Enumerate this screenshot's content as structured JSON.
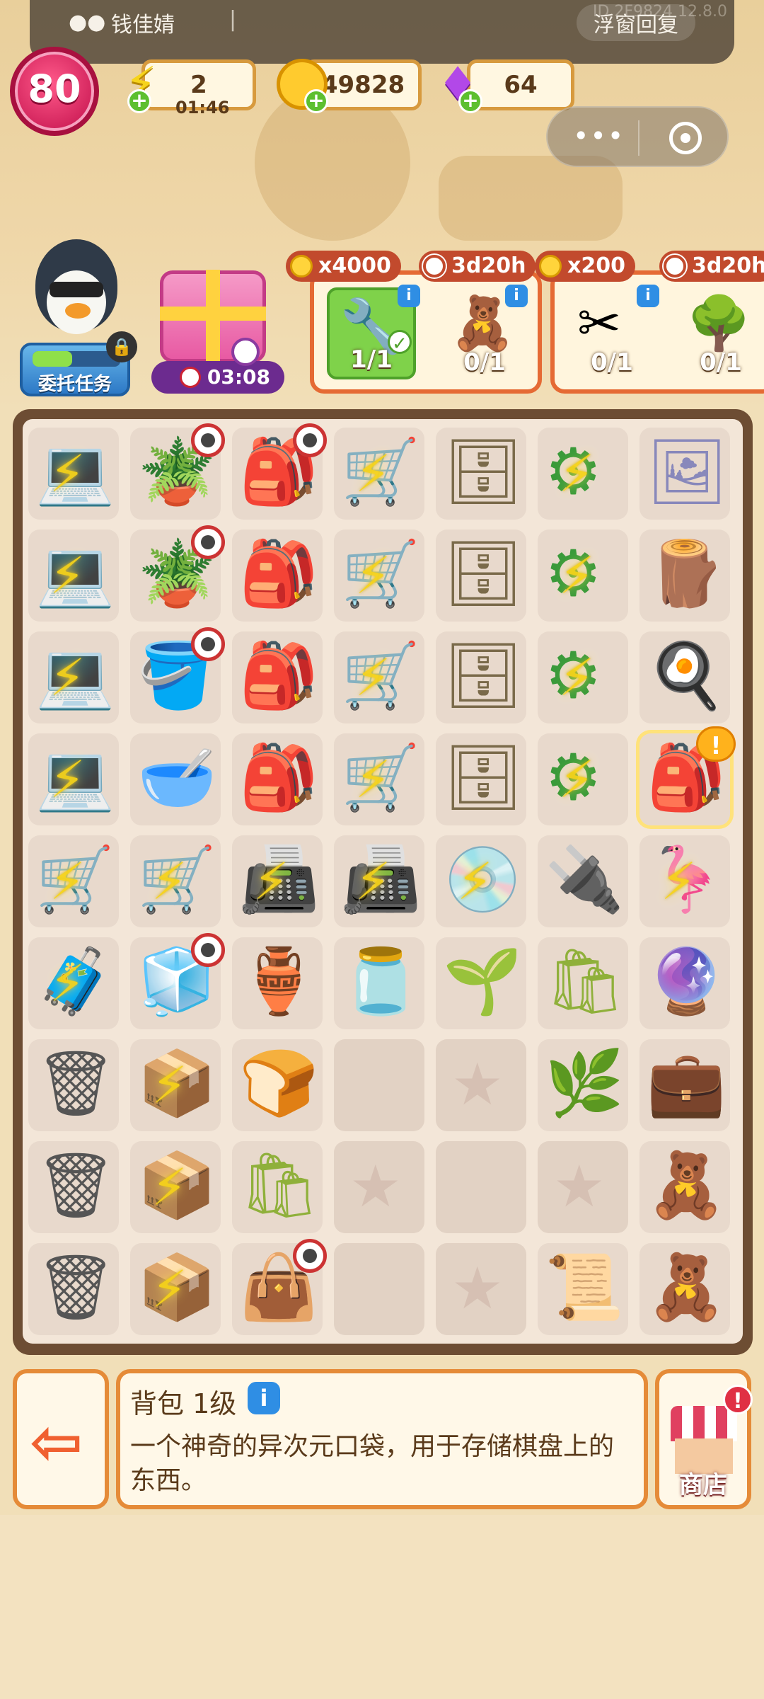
{
  "wechat_bar": {
    "name": "钱佳婧",
    "separator": "|",
    "right_label": "浮窗回复",
    "id_text": "ID 2F9824 12.8.0"
  },
  "level": {
    "value": "80"
  },
  "resources": {
    "energy": {
      "value": "2",
      "timer": "01:46",
      "icon": "energy-bolt-icon"
    },
    "coins": {
      "value": "49828",
      "icon": "coin-icon"
    },
    "gems": {
      "value": "64",
      "icon": "gem-icon"
    }
  },
  "capsule": {
    "more": "•••",
    "close": "close"
  },
  "mission": {
    "label": "委托任务",
    "progress": 0.45
  },
  "gift": {
    "timer": "03:08"
  },
  "orders": [
    {
      "reward": "x4000",
      "time": "3d20h",
      "items": [
        {
          "icon": "drill-icon",
          "count": "1/1",
          "done": true
        },
        {
          "icon": "teddy-bear-icon",
          "count": "0/1",
          "done": false
        }
      ]
    },
    {
      "reward": "x200",
      "time": "3d20h",
      "items": [
        {
          "icon": "pliers-icon",
          "count": "0/1",
          "done": false
        },
        {
          "icon": "potted-tree-icon",
          "count": "0/1",
          "done": false
        }
      ]
    }
  ],
  "board": {
    "rows": [
      [
        "laptop-icon",
        "plant-pot-icon",
        "junk-pile-icon",
        "shopping-cart-icon",
        "locker-icon",
        "green-machine-icon",
        "photos-icon"
      ],
      [
        "laptop-icon",
        "plant-pot-icon",
        "junk-pile-icon",
        "shopping-cart-icon",
        "locker-icon",
        "green-machine-icon",
        "firewood-icon"
      ],
      [
        "laptop-icon",
        "yellow-pot-icon",
        "junk-pile-icon",
        "shopping-cart-icon",
        "locker-icon",
        "green-machine-icon",
        "frying-pan-icon"
      ],
      [
        "laptop-icon",
        "mortar-icon",
        "junk-pile-icon",
        "shopping-cart-icon",
        "locker-icon",
        "green-machine-icon",
        "backpack-icon"
      ],
      [
        "hand-truck-icon",
        "hand-truck-icon",
        "blue-device-icon",
        "blue-device-icon",
        "blue-disc-icon",
        "circuit-board-icon",
        "flamingo-float-icon"
      ],
      [
        "pink-suitcase-icon",
        "pink-fridge-icon",
        "clay-pot-icon",
        "terrarium-icon",
        "seedling-icon",
        "seed-bag-icon",
        "energy-orb-icon"
      ],
      [
        "trash-bag-icon",
        "pink-box-icon",
        "bread-icon",
        "empty",
        "star",
        "seed-packet-icon",
        "green-case-icon"
      ],
      [
        "trash-bag-icon",
        "pink-box-icon",
        "seed-bag-icon",
        "star",
        "empty",
        "star",
        "teddy-outline-icon"
      ],
      [
        "trash-bag-icon",
        "pink-box-icon",
        "pink-bag-icon",
        "empty",
        "star",
        "seed-paper-icon",
        "teddy-outline-icon"
      ]
    ]
  },
  "info_panel": {
    "title": "背包 1级",
    "description": "一个神奇的异次元口袋，用于存储棋盘上的东西。"
  },
  "shop": {
    "label": "商店",
    "alert": "!"
  },
  "exit": {
    "icon": "exit-arrow-icon"
  }
}
